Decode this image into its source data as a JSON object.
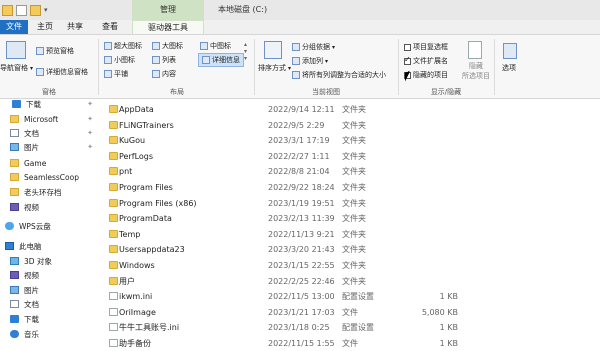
{
  "title_bar": {
    "manage_tab": "管理",
    "window_title": "本地磁盘 (C:)"
  },
  "ribbon_tabs": {
    "file": "文件",
    "home": "主页",
    "share": "共享",
    "view": "查看",
    "drive_tools": "驱动器工具"
  },
  "ribbon": {
    "panes": {
      "nav_pane": "导航窗格",
      "preview_pane": "预览窗格",
      "details_pane": "详细信息窗格",
      "label": "窗格"
    },
    "layout": {
      "extra_large": "超大图标",
      "large": "大图标",
      "medium": "中图标",
      "small": "小图标",
      "list": "列表",
      "details": "详细信息",
      "tiles": "平铺",
      "content": "内容",
      "label": "布局"
    },
    "current_view": {
      "sort_by": "排序方式",
      "group_by": "分组依据",
      "add_column": "添加列",
      "fit_columns": "将所有列调整为合适的大小",
      "label": "当前视图"
    },
    "show_hide": {
      "item_checkboxes": "项目复选框",
      "file_extensions": "文件扩展名",
      "hidden_items": "隐藏的项目",
      "hide_selected": "隐藏",
      "hide_selected2": "所选项目",
      "options": "选项",
      "label": "显示/隐藏",
      "item_checkboxes_checked": false,
      "file_extensions_checked": true,
      "hidden_items_checked": true
    }
  },
  "nav": [
    {
      "label": "下载",
      "pinned": true,
      "icon": "download-icon"
    },
    {
      "label": "Microsoft",
      "pinned": true,
      "icon": "folder-icon"
    },
    {
      "label": "文档",
      "pinned": true,
      "icon": "documents-icon"
    },
    {
      "label": "图片",
      "pinned": true,
      "icon": "pictures-icon"
    },
    {
      "label": "Game",
      "pinned": false,
      "icon": "folder-icon"
    },
    {
      "label": "SeamlessCoop",
      "pinned": false,
      "icon": "folder-icon"
    },
    {
      "label": "老头环存档",
      "pinned": false,
      "icon": "folder-icon"
    },
    {
      "label": "视频",
      "pinned": false,
      "icon": "videos-icon"
    },
    {
      "label": "WPS云盘",
      "pinned": false,
      "icon": "cloud-icon"
    },
    {
      "label": "此电脑",
      "pinned": false,
      "icon": "computer-icon"
    },
    {
      "label": "3D 对象",
      "pinned": false,
      "icon": "3d-objects-icon"
    },
    {
      "label": "视频",
      "pinned": false,
      "icon": "videos-icon"
    },
    {
      "label": "图片",
      "pinned": false,
      "icon": "pictures-icon"
    },
    {
      "label": "文档",
      "pinned": false,
      "icon": "documents-icon"
    },
    {
      "label": "下载",
      "pinned": false,
      "icon": "download-icon"
    },
    {
      "label": "音乐",
      "pinned": false,
      "icon": "music-icon"
    }
  ],
  "files": [
    {
      "name": "AppData",
      "date": "2022/9/14 12:11",
      "type": "文件夹",
      "size": "",
      "kind": "folder"
    },
    {
      "name": "FLiNGTrainers",
      "date": "2022/9/5 2:29",
      "type": "文件夹",
      "size": "",
      "kind": "folder"
    },
    {
      "name": "KuGou",
      "date": "2023/3/1 17:19",
      "type": "文件夹",
      "size": "",
      "kind": "folder"
    },
    {
      "name": "PerfLogs",
      "date": "2022/2/27 1:11",
      "type": "文件夹",
      "size": "",
      "kind": "folder"
    },
    {
      "name": "pnt",
      "date": "2022/8/8 21:04",
      "type": "文件夹",
      "size": "",
      "kind": "folder"
    },
    {
      "name": "Program Files",
      "date": "2022/9/22 18:24",
      "type": "文件夹",
      "size": "",
      "kind": "folder"
    },
    {
      "name": "Program Files (x86)",
      "date": "2023/1/19 19:51",
      "type": "文件夹",
      "size": "",
      "kind": "folder"
    },
    {
      "name": "ProgramData",
      "date": "2023/2/13 11:39",
      "type": "文件夹",
      "size": "",
      "kind": "folder"
    },
    {
      "name": "Temp",
      "date": "2022/11/13 9:21",
      "type": "文件夹",
      "size": "",
      "kind": "folder"
    },
    {
      "name": "Usersappdata23",
      "date": "2023/3/20 21:43",
      "type": "文件夹",
      "size": "",
      "kind": "folder"
    },
    {
      "name": "Windows",
      "date": "2023/1/15 22:55",
      "type": "文件夹",
      "size": "",
      "kind": "folder"
    },
    {
      "name": "用户",
      "date": "2022/2/25 22:46",
      "type": "文件夹",
      "size": "",
      "kind": "folder"
    },
    {
      "name": "ikwm.ini",
      "date": "2022/11/5 13:00",
      "type": "配置设置",
      "size": "1 KB",
      "kind": "file"
    },
    {
      "name": "OriImage",
      "date": "2023/1/21 17:03",
      "type": "文件",
      "size": "5,080 KB",
      "kind": "file"
    },
    {
      "name": "牛牛工具账号.ini",
      "date": "2023/1/18 0:25",
      "type": "配置设置",
      "size": "1 KB",
      "kind": "file"
    },
    {
      "name": "助手备份",
      "date": "2022/11/15 1:55",
      "type": "文件",
      "size": "1 KB",
      "kind": "file"
    }
  ]
}
